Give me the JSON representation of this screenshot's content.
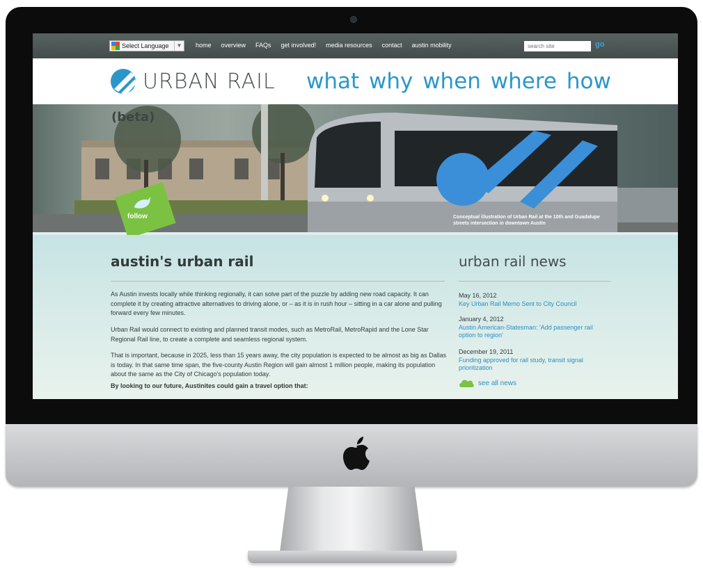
{
  "topbar": {
    "language_label": "Select Language",
    "language_arrow": "▼",
    "nav": [
      "home",
      "overview",
      "FAQs",
      "get involved!",
      "media resources",
      "contact",
      "austin mobility"
    ],
    "search_placeholder": "search site",
    "go_label": "go"
  },
  "header": {
    "logo_text": "URBAN RAIL",
    "tagline": "what why when where how"
  },
  "hero": {
    "beta": "(beta)",
    "follow": "follow",
    "caption": "Conceptual illustration of Urban Rail at the 10th and Guadalupe streets intersection in downtown Austin"
  },
  "main": {
    "heading": "austin's urban rail",
    "paragraphs": [
      "As Austin invests locally while thinking regionally, it can solve part of the puzzle by adding new road capacity. It can complete it by creating attractive alternatives to driving alone, or – as it is in rush hour – sitting in a car alone and pulling forward every few minutes.",
      "Urban Rail would connect to existing and planned transit modes, such as MetroRail, MetroRapid and the Lone Star Regional Rail line, to create a complete and seamless regional system.",
      "That is important, because in 2025, less than 15 years away, the city population is expected to be almost as big as Dallas is today. In that same time span, the five-county Austin Region will gain almost 1 million people, making its population about the same as the City of Chicago's population today.",
      "By looking to our future, Austinites could gain a travel option that:"
    ]
  },
  "news": {
    "heading": "urban rail news",
    "items": [
      {
        "date": "May 16, 2012",
        "title": "Key Urban Rail Memo Sent to City Council"
      },
      {
        "date": "January 4, 2012",
        "title": "Austin American-Statesman: 'Add passenger rail option to region'"
      },
      {
        "date": "December 19, 2011",
        "title": "Funding approved for rail study, transit signal prioritization"
      }
    ],
    "see_all": "see all news"
  },
  "colors": {
    "accent_blue": "#2b97c9",
    "link_blue": "#2b8fc1",
    "follow_green": "#7cc242",
    "topbar_gray": "#4d5756",
    "content_teal": "#c6e3e3"
  },
  "icons": [
    "google-translate-icon",
    "urban-rail-logo-icon",
    "bird-icon",
    "cloud-icon",
    "apple-logo-icon"
  ]
}
